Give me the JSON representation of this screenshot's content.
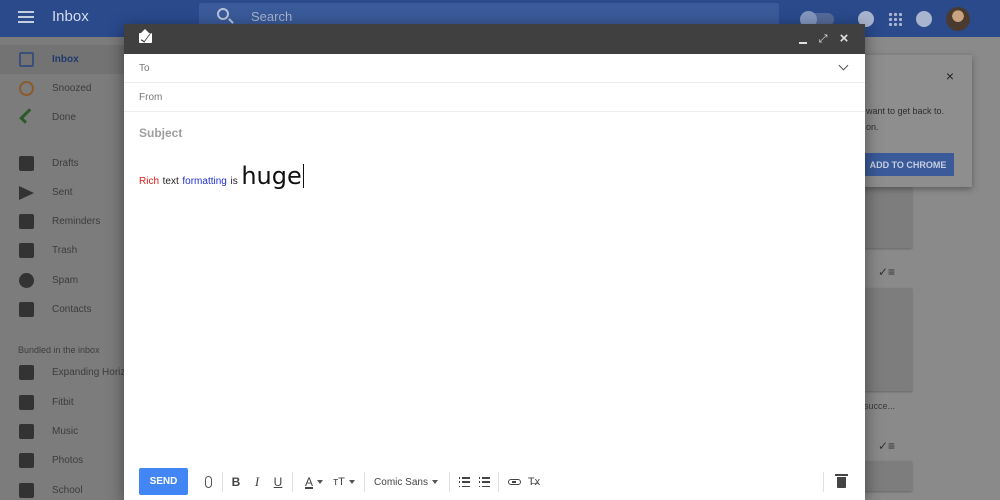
{
  "app": {
    "title": "Inbox",
    "search_placeholder": "Search"
  },
  "sidebar": {
    "items": [
      {
        "label": "Inbox"
      },
      {
        "label": "Snoozed"
      },
      {
        "label": "Done"
      },
      {
        "label": "Drafts"
      },
      {
        "label": "Sent"
      },
      {
        "label": "Reminders"
      },
      {
        "label": "Trash"
      },
      {
        "label": "Spam"
      },
      {
        "label": "Contacts"
      }
    ],
    "bundles_heading": "Bundled in the inbox",
    "bundles": [
      {
        "label": "Expanding Horizons"
      },
      {
        "label": "Fitbit"
      },
      {
        "label": "Music"
      },
      {
        "label": "Photos"
      },
      {
        "label": "School"
      }
    ]
  },
  "promo": {
    "line1": "want to get back to.",
    "line2": "on.",
    "button": "ADD TO CHROME",
    "close": "×"
  },
  "right_snippet": "succe...",
  "compose": {
    "to_label": "To",
    "from_label": "From",
    "subject_placeholder": "Subject",
    "body": {
      "word1": "Rich",
      "word2": "text",
      "word3": "formatting",
      "word4": "is",
      "word5": "huge"
    },
    "colors": {
      "rich": "#e01b1b",
      "formatting": "#1f2fd0",
      "send": "#4285f4"
    },
    "toolbar": {
      "send_label": "SEND",
      "bold": "B",
      "italic": "I",
      "underline": "U",
      "font_color": "A",
      "text_size": "тT",
      "font_name": "Comic Sans",
      "remove_format": "T̶x"
    }
  }
}
